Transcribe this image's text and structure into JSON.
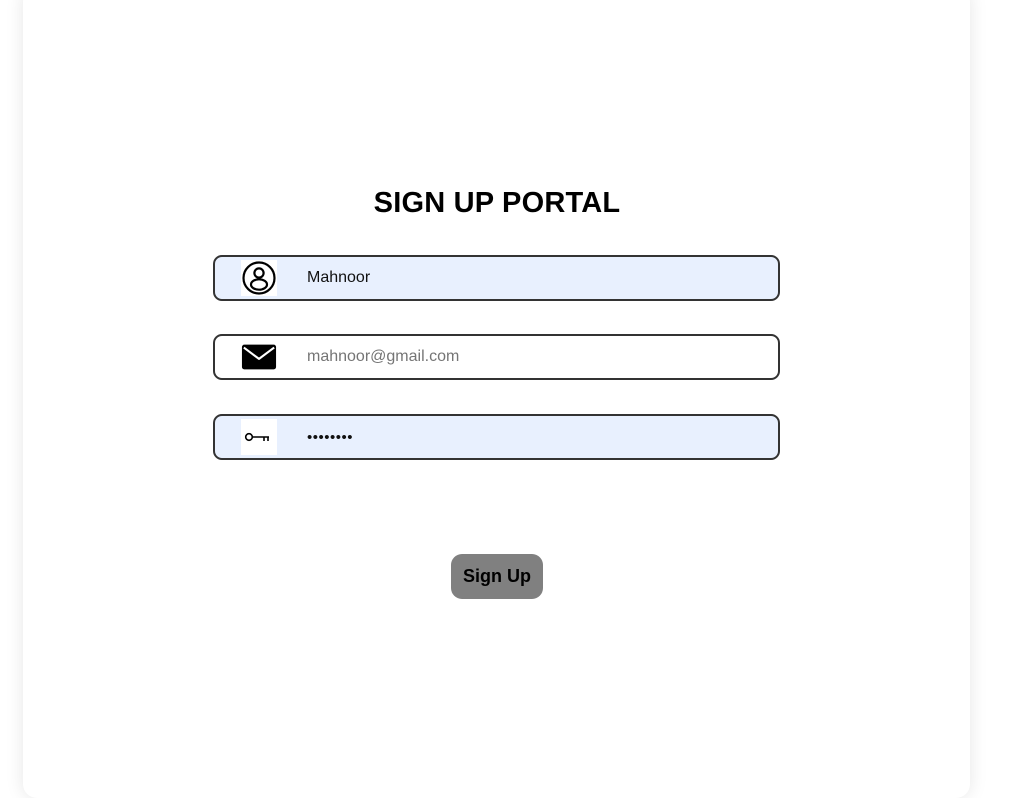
{
  "page": {
    "title": "SIGN UP PORTAL"
  },
  "form": {
    "name": {
      "value": "Mahnoor",
      "icon": "user-circle-icon"
    },
    "email": {
      "value": "",
      "placeholder": "mahnoor@gmail.com",
      "icon": "envelope-icon"
    },
    "password": {
      "value": "••••••••",
      "icon": "key-icon"
    },
    "submit_label": "Sign Up"
  },
  "colors": {
    "autofill_background": "#e8f0fe",
    "field_border": "#333333",
    "button_background": "#808080",
    "button_text": "#000000"
  }
}
